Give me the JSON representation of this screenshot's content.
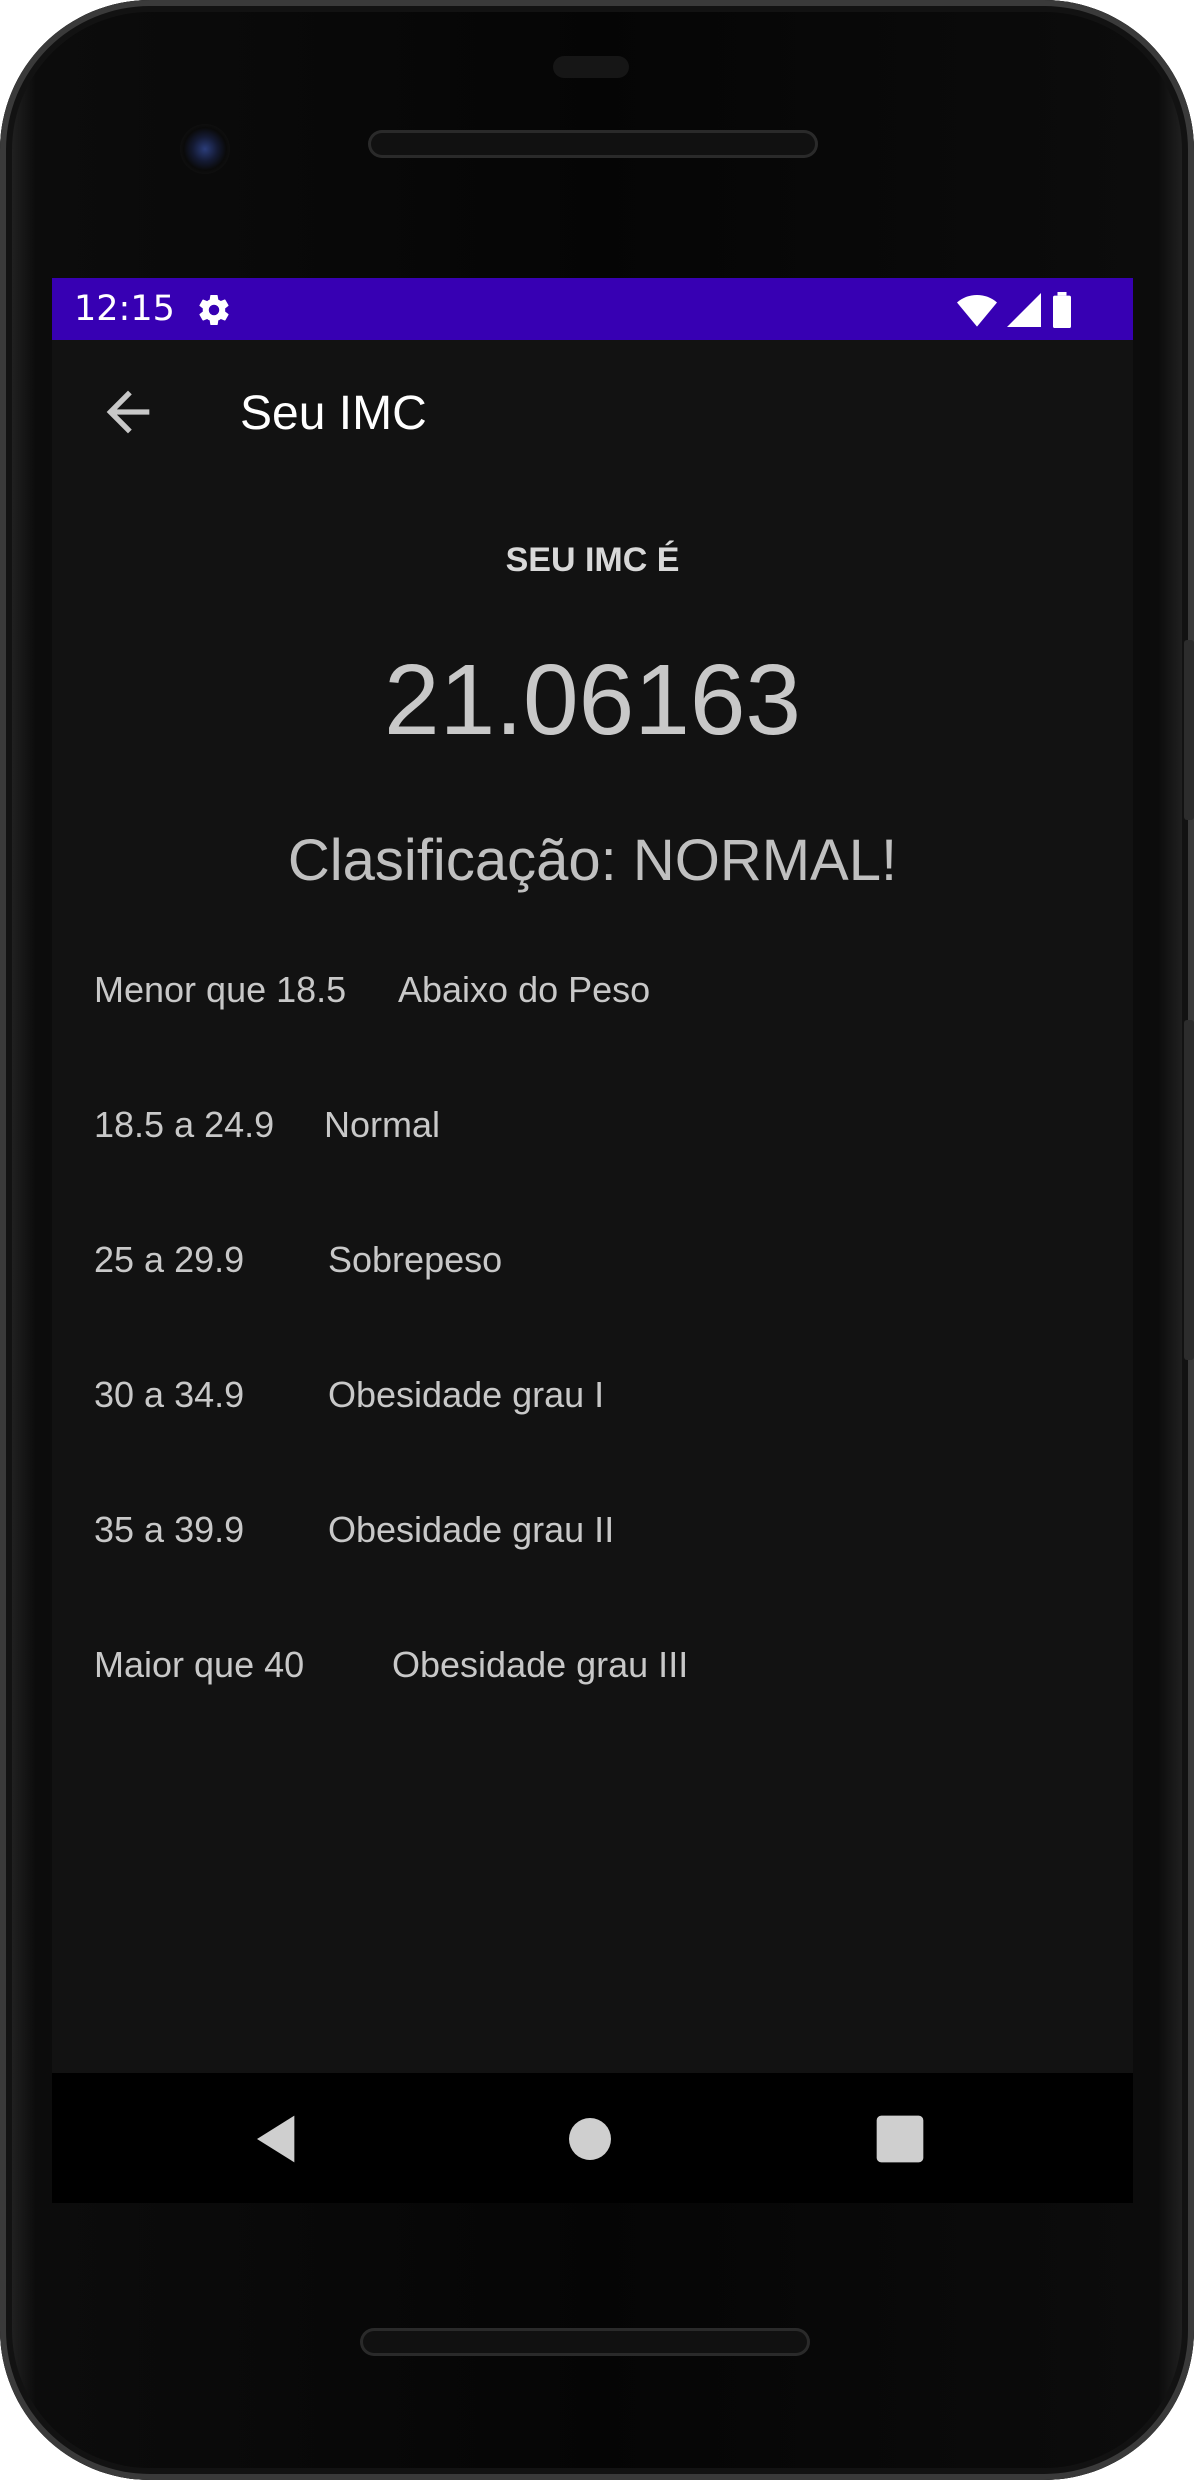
{
  "status_bar": {
    "time": "12:15",
    "icons": [
      "gear-icon",
      "wifi-icon",
      "cellular-signal-icon",
      "battery-icon"
    ],
    "background": "#3700b3"
  },
  "app_bar": {
    "title": "Seu IMC",
    "back_icon": "arrow-back-icon"
  },
  "result": {
    "label": "SEU IMC É",
    "value": "21.06163",
    "classification_prefix": "Clasificação: ",
    "classification_value": "NORMAL!"
  },
  "bmi_table": [
    {
      "range": "Menor que 18.5",
      "category": "Abaixo do Peso"
    },
    {
      "range": "18.5 a 24.9",
      "category": "Normal"
    },
    {
      "range": "25 a 29.9",
      "category": "Sobrepeso"
    },
    {
      "range": "30 a 34.9",
      "category": "Obesidade grau I"
    },
    {
      "range": "35 a 39.9",
      "category": "Obesidade grau II"
    },
    {
      "range": "Maior que 40",
      "category": "Obesidade grau III"
    }
  ],
  "navigation": {
    "buttons": [
      "back-triangle-icon",
      "home-circle-icon",
      "recents-square-icon"
    ]
  },
  "colors": {
    "screen_background": "#121212",
    "status_bar": "#3700b3",
    "text_primary": "#ffffff",
    "text_secondary": "#c8c8c8"
  }
}
